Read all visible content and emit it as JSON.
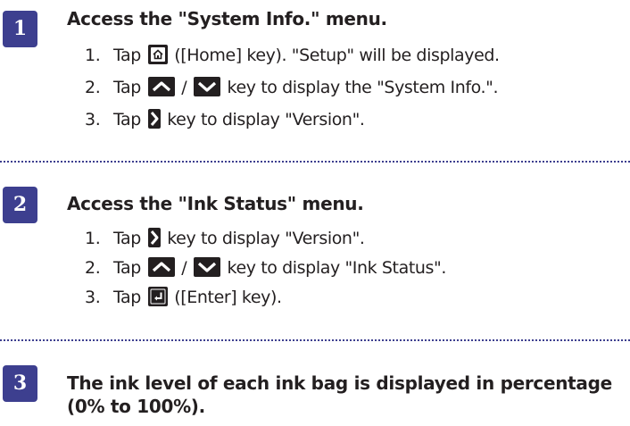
{
  "steps": [
    {
      "number": "1",
      "heading": "Access the \"System Info.\" menu.",
      "items": [
        {
          "num": "1.",
          "pre": "Tap ",
          "key": "home-key-icon",
          "post": " ([Home] key). \"Setup\" will be displayed."
        },
        {
          "num": "2.",
          "pre": "Tap ",
          "key": "up-down-keys",
          "sep": " / ",
          "post": " key to display the \"System Info.\"."
        },
        {
          "num": "3.",
          "pre": "Tap ",
          "key": "right-key-icon",
          "post": " key to display \"Version\"."
        }
      ]
    },
    {
      "number": "2",
      "heading": "Access the \"Ink Status\" menu.",
      "items": [
        {
          "num": "1.",
          "pre": "Tap ",
          "key": "right-key-icon",
          "post": " key to display \"Version\"."
        },
        {
          "num": "2.",
          "pre": "Tap ",
          "key": "up-down-keys",
          "sep": " / ",
          "post": " key to display \"Ink Status\"."
        },
        {
          "num": "3.",
          "pre": "Tap ",
          "key": "enter-key-icon",
          "post": " ([Enter] key)."
        }
      ]
    },
    {
      "number": "3",
      "heading": "The ink level of each ink bag is displayed in percentage (0% to 100%).",
      "items": []
    }
  ],
  "colors": {
    "accent": "#3d3f8f",
    "text": "#231f20",
    "key_bg": "#231f20"
  }
}
